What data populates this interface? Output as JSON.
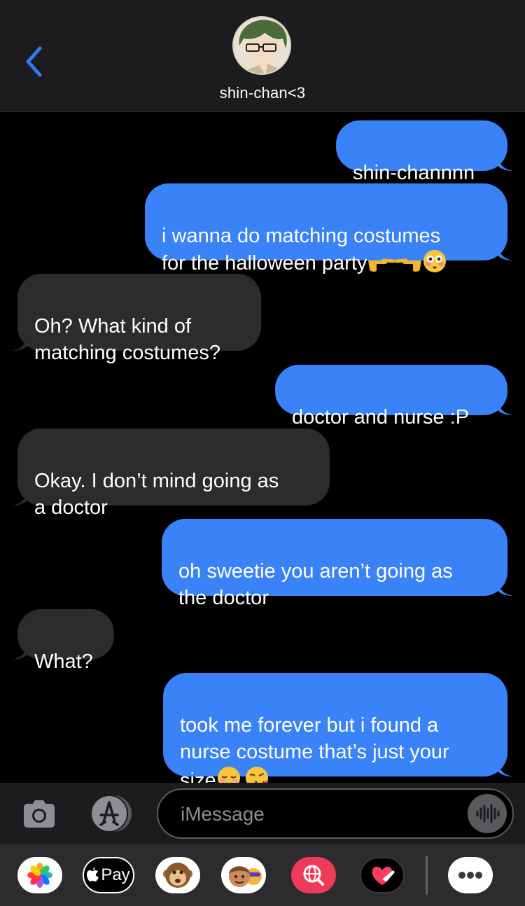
{
  "header": {
    "contact_name": "shin-chan<3",
    "back_icon": "chevron-left-icon",
    "accent": "#2f7cf6"
  },
  "messages": [
    {
      "from": "me",
      "text": "shin-channnn"
    },
    {
      "from": "me",
      "text": "i wanna do matching costumes\nfor the halloween party",
      "emoji": [
        "backhand-index-pointing-right",
        "backhand-index-pointing-left",
        "flushed-face"
      ]
    },
    {
      "from": "them",
      "text": "Oh? What kind of\nmatching costumes?"
    },
    {
      "from": "me",
      "text": "doctor and nurse :P"
    },
    {
      "from": "them",
      "text": "Okay. I don’t mind going as\na doctor"
    },
    {
      "from": "me",
      "text": "oh sweetie you aren’t going as\nthe doctor"
    },
    {
      "from": "them",
      "text": "What?"
    },
    {
      "from": "me",
      "text": "took me forever but i found a\nnurse costume that’s just your\nsize",
      "emoji": [
        "relieved-face",
        "face-blowing-kiss"
      ]
    }
  ],
  "composer": {
    "placeholder": "iMessage",
    "icons": [
      "camera-icon",
      "app-store-icon",
      "audio-waveform-icon"
    ]
  },
  "app_drawer": {
    "items": [
      {
        "name": "photos-app",
        "label": ""
      },
      {
        "name": "apple-pay-app",
        "label": "Pay"
      },
      {
        "name": "animoji-app",
        "label": ""
      },
      {
        "name": "memoji-app",
        "label": ""
      },
      {
        "name": "image-search-app",
        "label": ""
      },
      {
        "name": "digital-touch-app",
        "label": ""
      },
      {
        "name": "more-apps",
        "label": ""
      }
    ]
  },
  "colors": {
    "sent_bubble": "#3a82f7",
    "received_bubble": "#2c2c2e",
    "background": "#000000",
    "header": "#1c1c1e"
  }
}
